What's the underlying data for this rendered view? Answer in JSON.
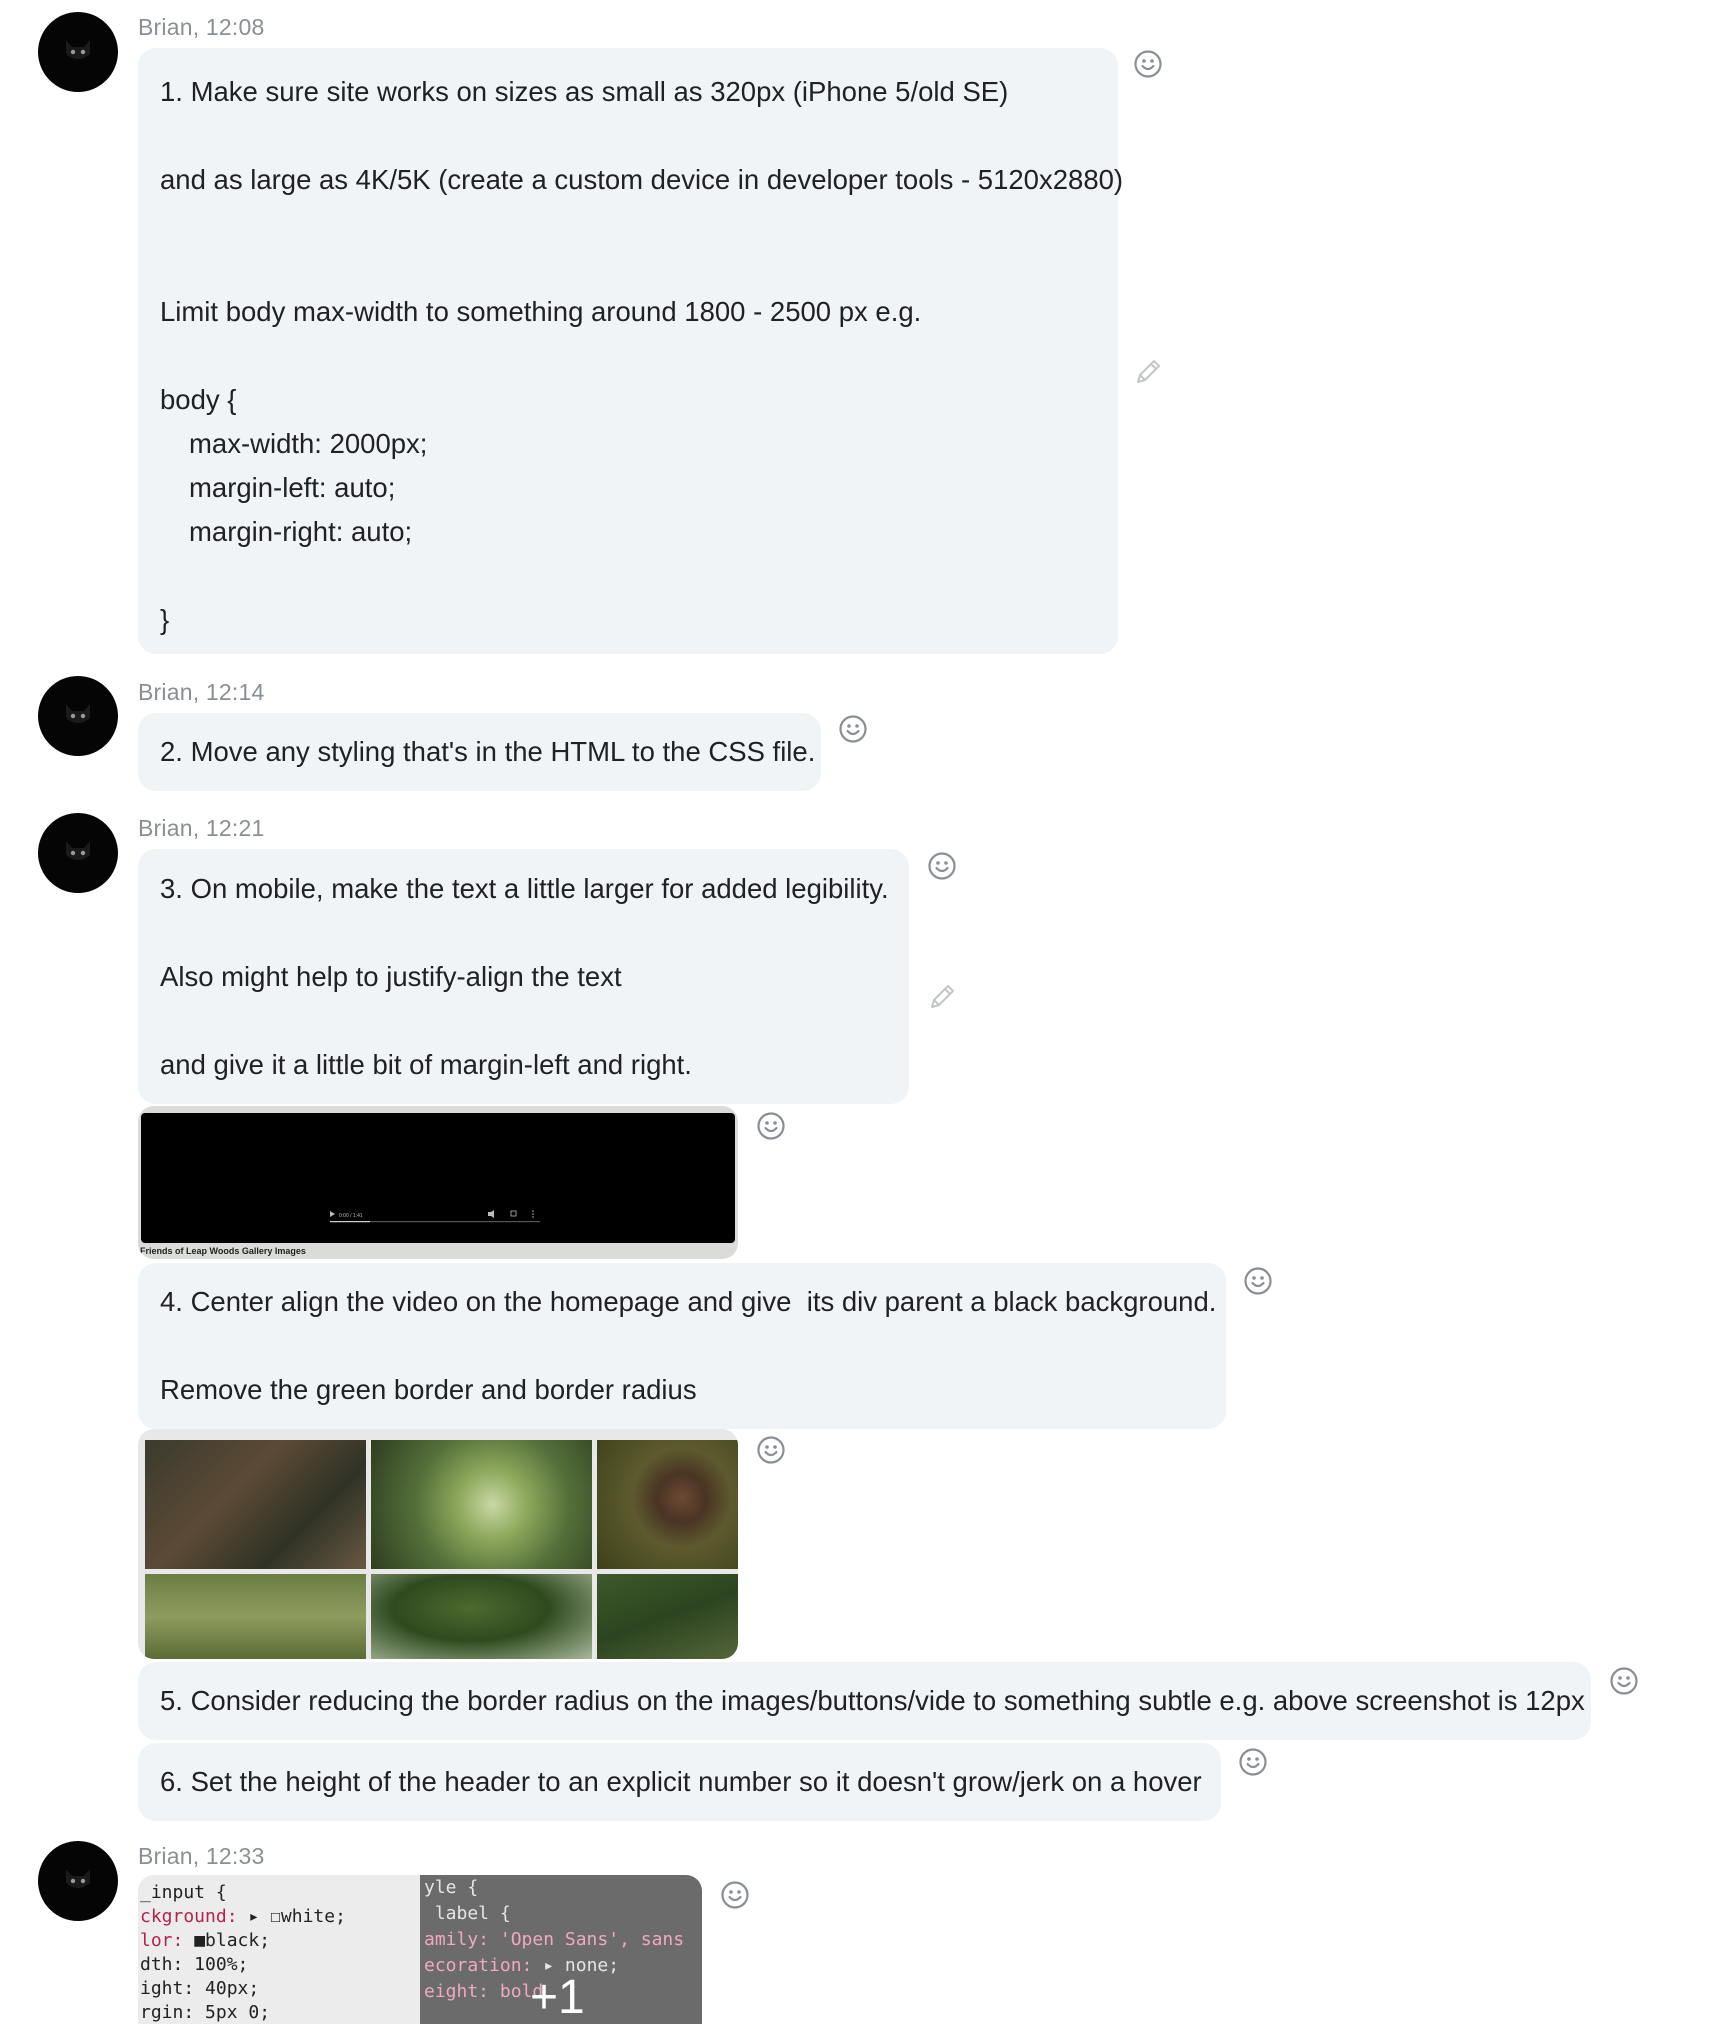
{
  "messages": [
    {
      "sender": "Brian, 12:08",
      "lines": [
        "1. Make sure site works on sizes as small as 320px (iPhone 5/old SE)",
        "and as large as 4K/5K (create a custom device in developer tools - 5120x2880)",
        "Limit body max-width to something around 1800 - 2500 px e.g.",
        "body {",
        "max-width: 2000px;",
        "margin-left: auto;",
        "margin-right: auto;",
        "}"
      ]
    },
    {
      "sender": "Brian, 12:14",
      "lines": [
        "2. Move any styling that's in the HTML to the CSS file."
      ]
    },
    {
      "sender": "Brian, 12:21",
      "lines": [
        "3. On mobile, make the text a little larger for added legibility.",
        "Also might help to justify-align the text",
        "and give it a little bit of margin-left and right."
      ],
      "video_caption": "Friends of Leap Woods Gallery Images",
      "video_time": "0:00 / 1:41"
    },
    {
      "lines": [
        "4. Center align the video on the homepage and give  its div parent a black background.",
        "Remove the green border and border radius"
      ]
    },
    {
      "lines": [
        "5. Consider reducing the border radius on the images/buttons/vide to something subtle e.g. above screenshot is 12px"
      ]
    },
    {
      "lines": [
        "6. Set the height of the header to an explicit number so it doesn't grow/jerk on a hover"
      ]
    },
    {
      "sender": "Brian, 12:33",
      "code_left": [
        "_input {",
        "ckground:",
        "lor:",
        "dth: 100%;",
        "ight: 40px;",
        "rgin: 5px 0;"
      ],
      "code_left_values": [
        "white;",
        "black;"
      ],
      "code_right": [
        "yle {",
        " label {",
        "amily: 'Open Sans', sans",
        "ecoration:",
        "eight: bold"
      ],
      "code_right_value": "none;",
      "overflow_count": "+1"
    }
  ],
  "icons": {
    "react": "smiley-face-icon",
    "edit": "pencil-icon",
    "avatar": "black-cat-avatar"
  },
  "colors": {
    "bubble": "#f1f4f7",
    "meta_text": "#8a8f94",
    "icon": "#8a8f94"
  }
}
